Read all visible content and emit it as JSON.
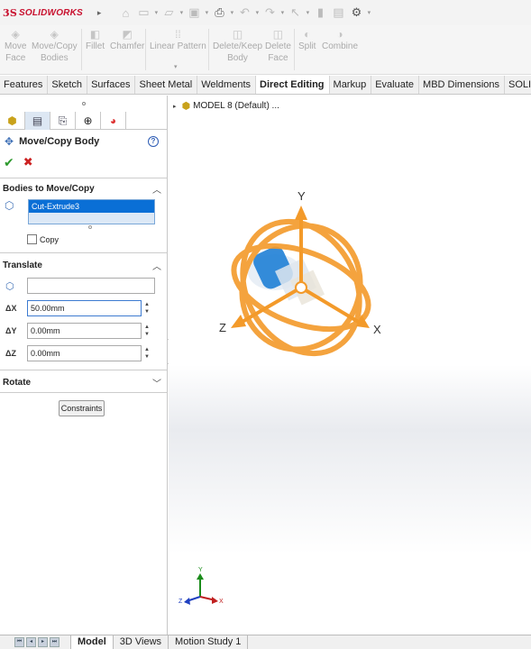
{
  "app": {
    "logo_mark": "3S",
    "logo_text": "SOLIDWORKS"
  },
  "ribbon": {
    "move_face": [
      "Move",
      "Face"
    ],
    "move_copy_bodies": [
      "Move/Copy",
      "Bodies"
    ],
    "fillet": "Fillet",
    "chamfer": "Chamfer",
    "linear_pattern": "Linear Pattern",
    "delete_keep_body": [
      "Delete/Keep",
      "Body"
    ],
    "delete_face": [
      "Delete",
      "Face"
    ],
    "split": "Split",
    "combine": "Combine"
  },
  "tabs": [
    "Features",
    "Sketch",
    "Surfaces",
    "Sheet Metal",
    "Weldments",
    "Direct Editing",
    "Markup",
    "Evaluate",
    "MBD Dimensions",
    "SOLI"
  ],
  "active_tab": "Direct Editing",
  "property_manager": {
    "title": "Move/Copy Body",
    "help": "?",
    "bodies_section": "Bodies to Move/Copy",
    "selected_body": "Cut-Extrude3",
    "copy_label": "Copy",
    "copy_checked": false,
    "translate_section": "Translate",
    "reference_value": "",
    "dx_label": "ΔX",
    "dx_value": "50.00mm",
    "dy_label": "ΔY",
    "dy_value": "0.00mm",
    "dz_label": "ΔZ",
    "dz_value": "0.00mm",
    "rotate_section": "Rotate",
    "constraints_button": "Constraints"
  },
  "viewport": {
    "tree_label": "MODEL 8  (Default) ...",
    "axis_x": "X",
    "axis_y": "Y",
    "axis_z": "Z",
    "triad_x": "X",
    "triad_y": "Y",
    "triad_z": "Z"
  },
  "bottom_tabs": [
    "Model",
    "3D Views",
    "Motion Study 1"
  ],
  "colors": {
    "accent": "#f39a2a",
    "selection": "#0a6fd6",
    "brand": "#c8102e"
  }
}
